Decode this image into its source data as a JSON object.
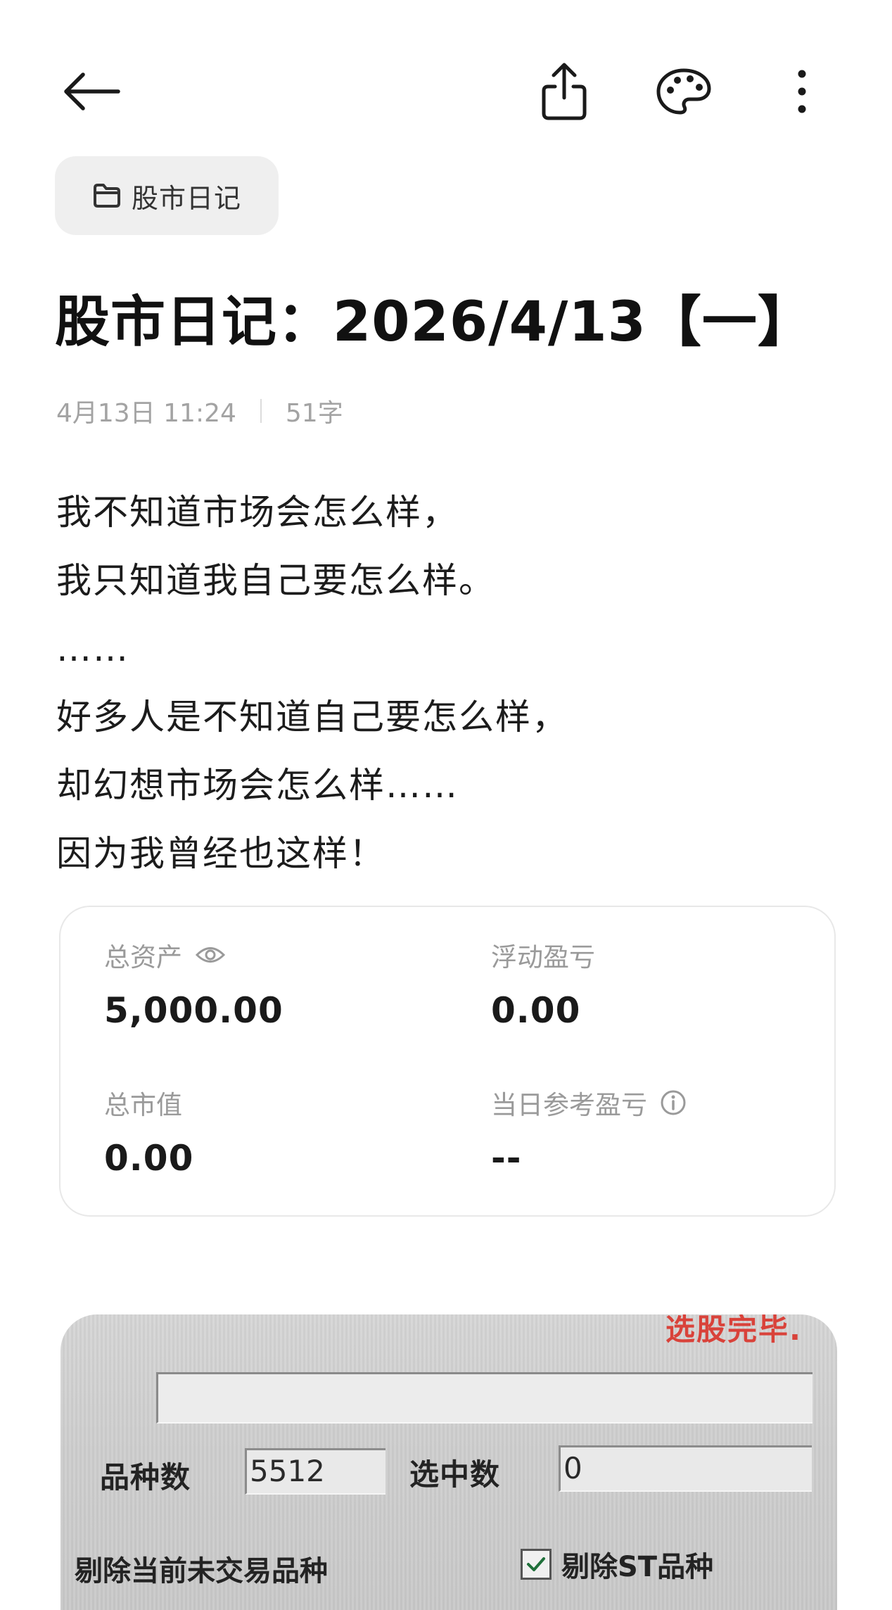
{
  "toolbar": {
    "icons": [
      "back-arrow-icon",
      "share-icon",
      "palette-icon",
      "more-vertical-icon"
    ]
  },
  "folder": {
    "label": "股市日记",
    "icon": "folder-icon"
  },
  "note": {
    "title": "股市日记：2026/4/13【一】",
    "date": "4月13日 11:24",
    "word_count": "51字",
    "lines": [
      "我不知道市场会怎么样，",
      "我只知道我自己要怎么样。",
      "……",
      "好多人是不知道自己要怎么样，",
      "却幻想市场会怎么样……",
      "因为我曾经也这样！"
    ]
  },
  "assets": {
    "total_assets_label": "总资产",
    "total_assets_value": "5,000.00",
    "floating_pl_label": "浮动盈亏",
    "floating_pl_value": "0.00",
    "market_value_label": "总市值",
    "market_value_value": "0.00",
    "daily_pl_label": "当日参考盈亏",
    "daily_pl_value": "--",
    "icons": [
      "eye-icon",
      "info-icon"
    ]
  },
  "photo": {
    "status_text": "选股完毕.",
    "variety_count_label": "品种数",
    "variety_count_value": "5512",
    "selected_count_label": "选中数",
    "selected_count_value": "0",
    "exclude_untraded_label": "剔除当前未交易品种",
    "exclude_st_label": "剔除ST品种",
    "exclude_st_checked": true,
    "colors": {
      "status": "#d9423a"
    }
  }
}
